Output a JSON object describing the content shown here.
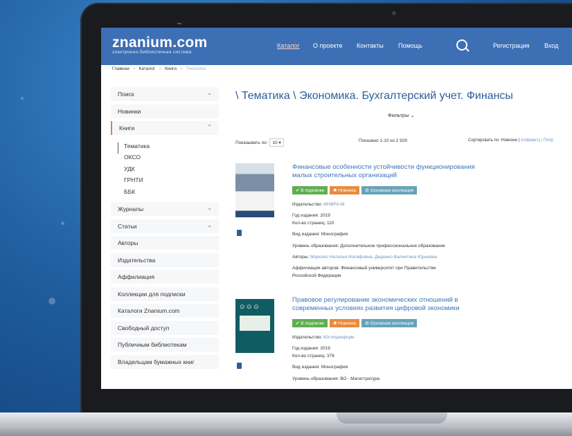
{
  "header": {
    "logo": "znanium.com",
    "logo_sub": "электронно-библиотечная система",
    "nav": [
      "Каталог",
      "О проекте",
      "Контакты",
      "Помощь"
    ],
    "register": "Регистрация",
    "login": "Вход"
  },
  "breadcrumb": [
    "Главная",
    "Каталог",
    "Книги",
    "Тематика"
  ],
  "sidebar": {
    "items_top": [
      "Поиск",
      "Новинки",
      "Книги"
    ],
    "books_sub": [
      "Тематика",
      "ОКСО",
      "УДК",
      "ГРНТИ",
      "ББК"
    ],
    "items_bottom": [
      "Журналы",
      "Статьи",
      "Авторы",
      "Издательства",
      "Аффилиация",
      "Коллекции для подписки",
      "Каталоги Znanium.com",
      "Свободный доступ",
      "Публичным библиотекам",
      "Владельцам бумажных книг"
    ]
  },
  "main": {
    "title": "\\ Тематика \\ Экономика. Бухгалтерский учет. Финансы",
    "filters": "Фильтры ⌄",
    "show_per_label": "Показывать по:",
    "show_per_value": "10",
    "shown": "Показано 1-10 из 2 929",
    "sort_label": "Сортировать по: Новизне",
    "sort_sep": "|",
    "sort_alt": "Алфавиту | Попу"
  },
  "badges": {
    "sub": "✔ В подписке",
    "new": "✱ Новинка",
    "collection": "⚙ Основная коллекция"
  },
  "books": [
    {
      "title": "Финансовые особенности устойчивости функционирования малых строительных организаций",
      "publisher_label": "Издательство:",
      "publisher": "ИНФРА-М",
      "year_label": "Год издания:",
      "year": "2019",
      "pages_label": "Кол-во страниц:",
      "pages": "110",
      "type_label": "Вид издания:",
      "type": "Монография",
      "level_label": "Уровень образования:",
      "level": "Дополнительное профессиональное образование",
      "authors_label": "Авторы:",
      "authors": "Морозко Наталья Иосифовна, Диденко Валентина Юрьевна",
      "affil_label": "Аффилиация авторов:",
      "affil_1": "Финансовый университет при Правительстве",
      "affil_2": "Российской Федерации"
    },
    {
      "title": "Правовое регулирование экономических отношений в современных условиях развития цифровой экономики",
      "publisher_label": "Издательство:",
      "publisher": "Юстицинформ",
      "year_label": "Год издания:",
      "year": "2019",
      "pages_label": "Кол-во страниц:",
      "pages": "376",
      "type_label": "Вид издания:",
      "type": "Монография",
      "level_label": "Уровень образования:",
      "level": "ВО - Магистратура"
    }
  ]
}
